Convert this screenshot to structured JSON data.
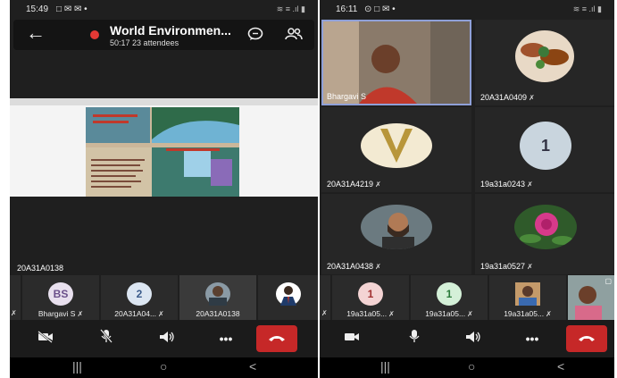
{
  "left": {
    "status_time": "15:49",
    "status_icons": "□ ✉ ✉ •",
    "status_right": "≋ ≡ .ıl ▮",
    "meeting": {
      "title": "World Environmen...",
      "duration": "50:17",
      "attendees": "23 attendees"
    },
    "presenter_label": "20A31A0138",
    "strip": [
      {
        "initials": "BS",
        "label": "Bhargavi S",
        "color": "#e8e0ee"
      },
      {
        "initials": "2",
        "label": "20A31A04...",
        "color": "#dce6f2"
      },
      {
        "initials": "",
        "label": "20A31A0138",
        "color": "#8a9aa5"
      },
      {
        "initials": "",
        "label": "",
        "color": "#ffffff"
      }
    ]
  },
  "right": {
    "status_time": "16:11",
    "status_icons": "⊙ □ ✉ •",
    "status_right": "≋ ≡ .ıl ▮",
    "tiles": [
      {
        "label": "Bhargavi S"
      },
      {
        "label": "20A31A0409"
      },
      {
        "label": "20A31A4219"
      },
      {
        "label": "19a31a0243",
        "initials": "1"
      },
      {
        "label": "20A31A0438"
      },
      {
        "label": "19a31a0527"
      }
    ],
    "strip": [
      {
        "initials": "1",
        "label": "19a31a05...",
        "color": "#f4d4d4"
      },
      {
        "initials": "1",
        "label": "19a31a05...",
        "color": "#d4f0d8"
      },
      {
        "initials": "",
        "label": "19a31a05...",
        "color": "#c49a6a"
      }
    ]
  },
  "icons": {
    "back": "back-arrow-icon",
    "chat": "chat-icon",
    "people": "people-icon",
    "camera_off": "camera-off-icon",
    "camera": "camera-icon",
    "mic_off": "mic-off-icon",
    "mic": "mic-icon",
    "speaker": "speaker-icon",
    "more": "more-icon",
    "end_call": "end-call-icon"
  },
  "nav": {
    "recents": "|||",
    "home": "○",
    "back": "<"
  },
  "colors": {
    "background": "#1f1f1f",
    "end_call": "#c62828",
    "recording": "#e53935",
    "selected_tile_border": "#8fa0d8"
  }
}
